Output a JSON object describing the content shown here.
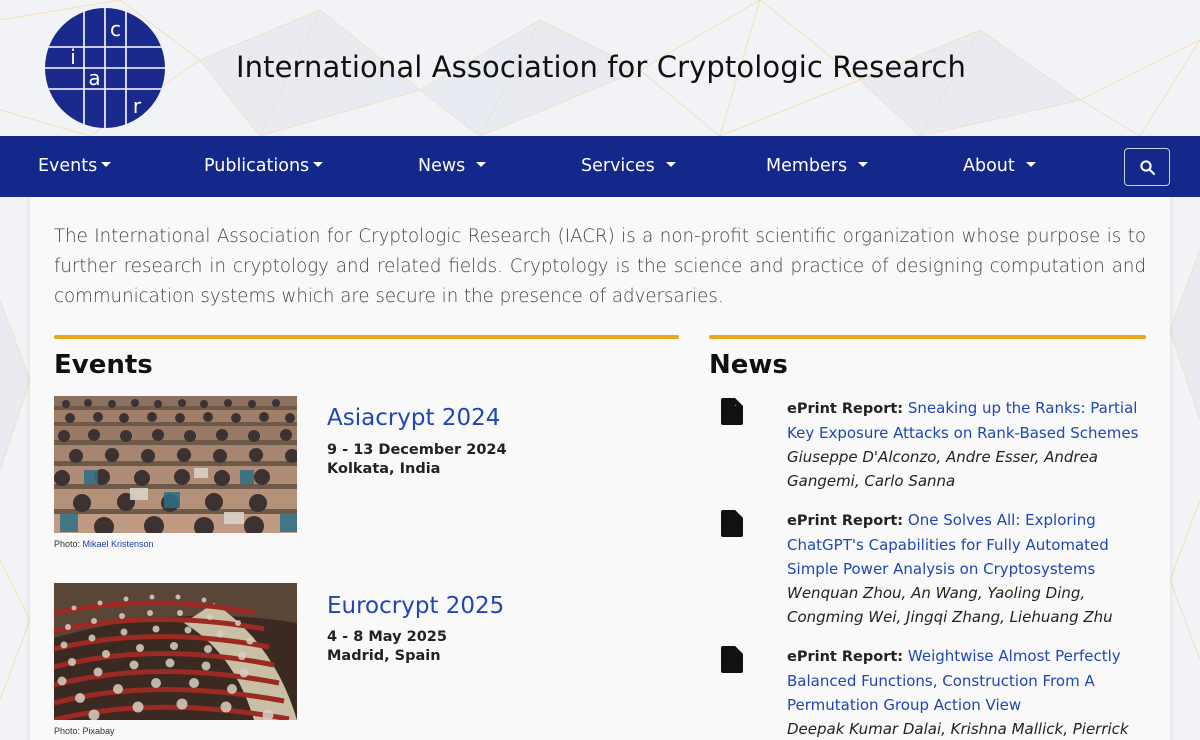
{
  "header": {
    "title": "International Association for Cryptologic Research",
    "logo_letters": [
      "c",
      "i",
      "a",
      "r"
    ]
  },
  "nav": {
    "items": [
      {
        "label": "Events"
      },
      {
        "label": "Publications"
      },
      {
        "label": "News"
      },
      {
        "label": "Services"
      },
      {
        "label": "Members"
      },
      {
        "label": "About"
      }
    ],
    "search_icon": "search-icon"
  },
  "intro": "The International Association for Cryptologic Research (IACR) is a non-profit scientific organization whose purpose is to further research in cryptology and related fields. Cryptology is the science and practice of designing computation and communication systems which are secure in the presence of adversaries.",
  "events": {
    "heading": "Events",
    "items": [
      {
        "title": "Asiacrypt 2024",
        "dates": "9 - 13 December 2024",
        "location": "Kolkata, India",
        "credit_prefix": "Photo: ",
        "credit_name": "Mikael Kristenson"
      },
      {
        "title": "Eurocrypt 2025",
        "dates": "4 - 8 May 2025",
        "location": "Madrid, Spain",
        "credit_prefix": "Photo: ",
        "credit_name": "Pixabay"
      }
    ]
  },
  "news": {
    "heading": "News",
    "items": [
      {
        "label": "ePrint Report:",
        "title": "Sneaking up the Ranks: Partial Key Exposure Attacks on Rank-Based Schemes",
        "authors": "Giuseppe D'Alconzo, Andre Esser, Andrea Gangemi, Carlo Sanna"
      },
      {
        "label": "ePrint Report:",
        "title": "One Solves All: Exploring ChatGPT's Capabilities for Fully Automated Simple Power Analysis on Cryptosystems",
        "authors": "Wenquan Zhou, An Wang, Yaoling Ding, Congming Wei, Jingqi Zhang, Liehuang Zhu"
      },
      {
        "label": "ePrint Report:",
        "title": "Weightwise Almost Perfectly Balanced Functions, Construction From A Permutation Group Action View",
        "authors": "Deepak Kumar Dalai, Krishna Mallick, Pierrick"
      }
    ]
  },
  "colors": {
    "nav_bg": "#13288a",
    "accent_rule": "#e6a817",
    "link": "#2046b5",
    "logo_blue": "#1a2a8c"
  }
}
